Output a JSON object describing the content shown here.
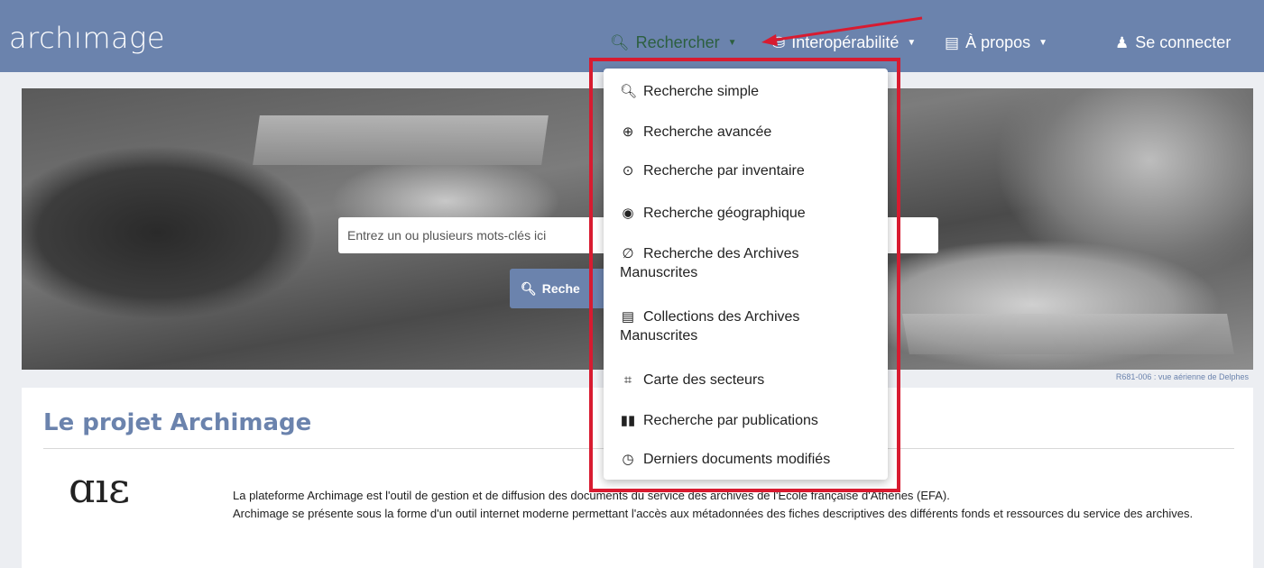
{
  "navbar": {
    "logo": "archımage",
    "search_label": "Rechercher",
    "interop_label": "Interopérabilité",
    "about_label": "À propos",
    "login_label": "Se connecter",
    "colors": {
      "bar": "#6b83ad",
      "active": "#2c5f3f"
    }
  },
  "hero": {
    "search_placeholder": "Entrez un ou plusieurs mots-clés ici",
    "search_value": "Entrez un ou plusieurs mots-clés ici",
    "search_button": "Reche",
    "credit": "R681-006 : vue aérienne de Delphes"
  },
  "dropdown": {
    "items": [
      {
        "icon": "search-icon",
        "label": "Recherche simple"
      },
      {
        "icon": "zoom-in-icon",
        "label": "Recherche avancée"
      },
      {
        "icon": "zoom-icon",
        "label": "Recherche par inventaire"
      },
      {
        "icon": "map-marker-icon",
        "label": "Recherche géographique"
      },
      {
        "icon": "ban-icon",
        "label": "Recherche des Archives Manuscrites"
      },
      {
        "icon": "list-alt-icon",
        "label": "Collections des Archives Manuscrites"
      },
      {
        "icon": "fullscreen-icon",
        "label": "Carte des secteurs"
      },
      {
        "icon": "book-icon",
        "label": "Recherche par publications"
      },
      {
        "icon": "clock-icon",
        "label": "Derniers documents modifiés"
      }
    ]
  },
  "content": {
    "title": "Le projet Archimage",
    "logo": "ɑıε",
    "description_1": "La plateforme Archimage est l'outil de gestion et de diffusion des documents du service des archives de l'École française d'Athènes (EFA).",
    "description_2": "Archimage se présente sous la forme d'un outil internet moderne permettant l'accès aux métadonnées des fiches descriptives des différents fonds et ressources du service des archives."
  }
}
